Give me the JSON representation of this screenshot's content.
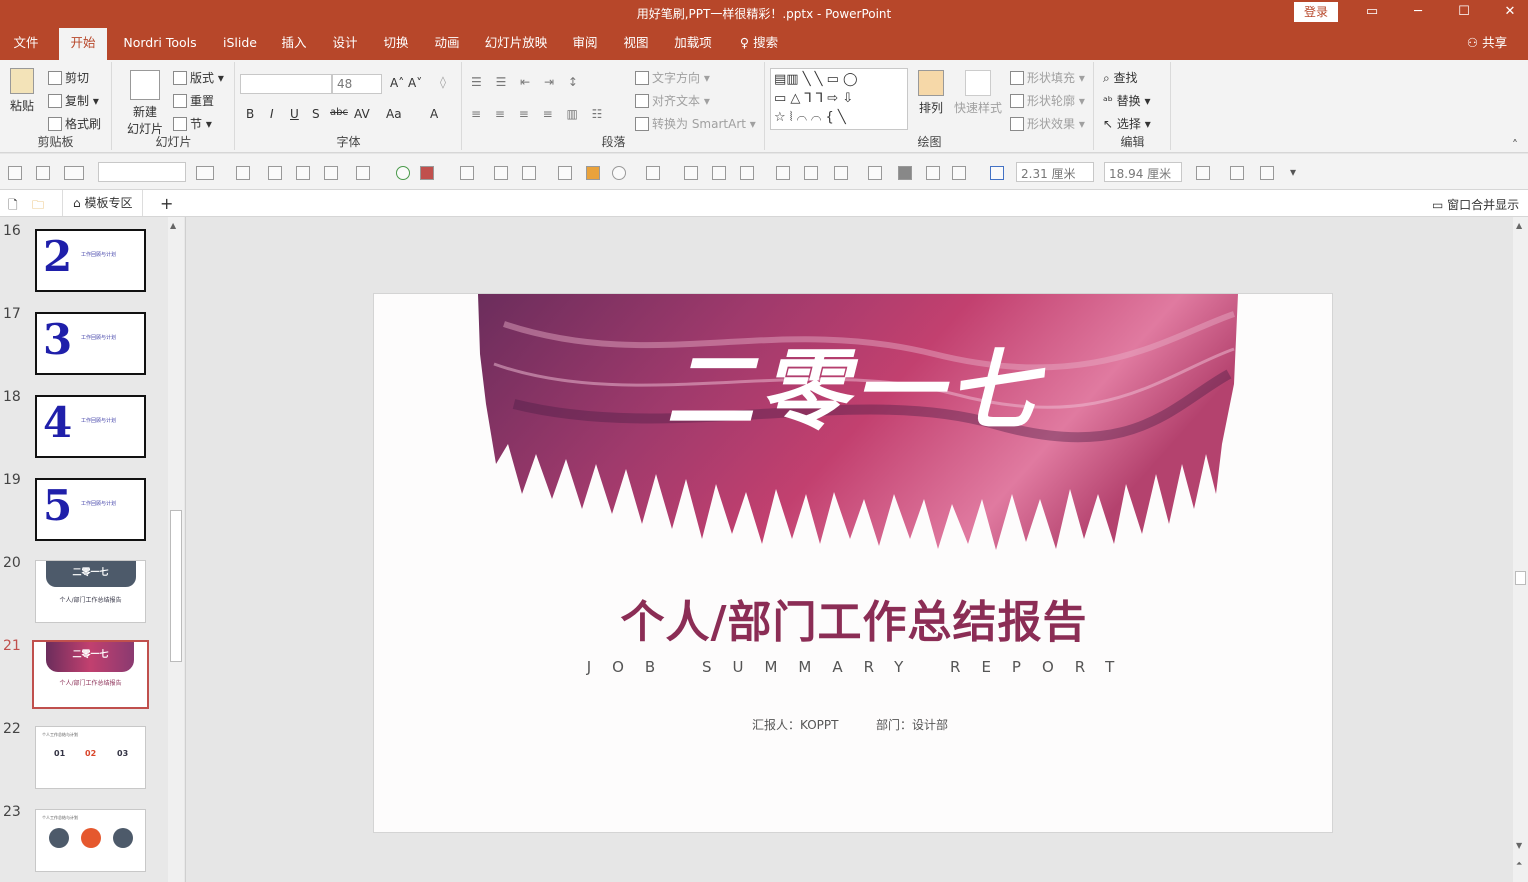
{
  "window": {
    "title": "用好笔刷,PPT一样很精彩！.pptx  -  PowerPoint",
    "login": "登录"
  },
  "menu": {
    "tabs": [
      "文件",
      "开始",
      "Nordri Tools",
      "iSlide",
      "插入",
      "设计",
      "切换",
      "动画",
      "幻灯片放映",
      "审阅",
      "视图",
      "加载项"
    ],
    "search": "搜索",
    "share": "共享"
  },
  "ribbon": {
    "clipboard": {
      "paste": "粘贴",
      "cut": "剪切",
      "copy": "复制",
      "format_painter": "格式刷",
      "label": "剪贴板"
    },
    "slides": {
      "new_slide_1": "新建",
      "new_slide_2": "幻灯片",
      "layout": "版式",
      "reset": "重置",
      "section": "节",
      "label": "幻灯片"
    },
    "font": {
      "size": "48",
      "label": "字体",
      "bold": "B",
      "italic": "I",
      "underline": "U",
      "shadow": "S",
      "strike": "abc",
      "spacing": "AV",
      "case": "Aa",
      "color": "A"
    },
    "paragraph": {
      "text_direction": "文字方向",
      "align_text": "对齐文本",
      "smartart": "转换为 SmartArt",
      "label": "段落"
    },
    "drawing": {
      "arrange": "排列",
      "quick_styles": "快速样式",
      "fill": "形状填充",
      "outline": "形状轮廓",
      "effects": "形状效果",
      "label": "绘图"
    },
    "editing": {
      "find": "查找",
      "replace": "替换",
      "select": "选择",
      "label": "编辑"
    }
  },
  "qat": {
    "height": "2.31 厘米",
    "width": "18.94 厘米"
  },
  "tabstrip": {
    "template": "模板专区",
    "merge": "窗口合并显示"
  },
  "slides": [
    {
      "num": "16",
      "glyph": "2",
      "text": "工作回顾与计划"
    },
    {
      "num": "17",
      "glyph": "3",
      "text": "工作回顾与计划"
    },
    {
      "num": "18",
      "glyph": "4",
      "text": "工作回顾与计划"
    },
    {
      "num": "19",
      "glyph": "5",
      "text": "工作回顾与计划"
    },
    {
      "num": "20",
      "hero": "二零一七",
      "text": "个人/部门工作总结报告"
    },
    {
      "num": "21",
      "hero": "二零一七",
      "text": "个人/部门工作总结报告"
    },
    {
      "num": "22",
      "text": "个人工作总结与计划",
      "n1": "01",
      "n2": "02",
      "n3": "03"
    },
    {
      "num": "23",
      "text": "个人工作总结与计划"
    }
  ],
  "slide": {
    "hero": "二零一七",
    "title": "个人/部门工作总结报告",
    "subtitle": "JOB SUMMARY REPORT",
    "reporter": "汇报人：KOPPT",
    "department": "部门：设计部"
  },
  "colors": {
    "accent": "#b7472a",
    "brush_dark": "#6b2d5c",
    "brush_mid": "#c2406f",
    "brush_light": "#e07aa0",
    "title": "#8b2d55"
  }
}
